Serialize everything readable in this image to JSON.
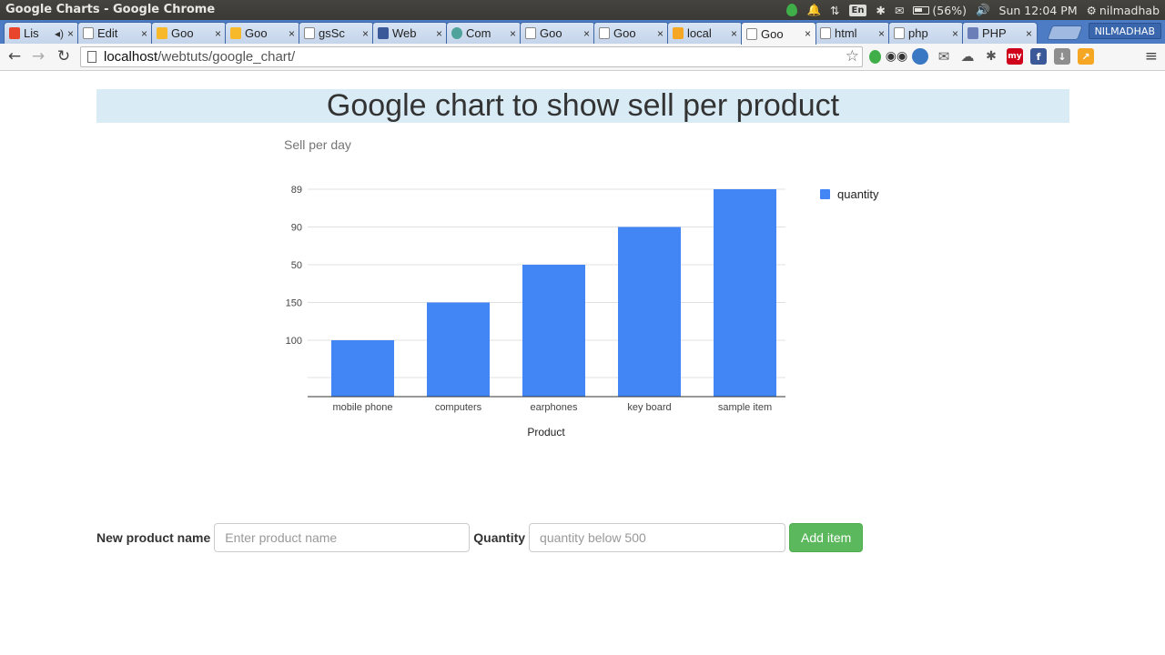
{
  "os_bar": {
    "window_title": "Google Charts - Google Chrome",
    "lang": "En",
    "battery": "(56%)",
    "clock": "Sun 12:04 PM",
    "user": "nilmadhab"
  },
  "tabs": [
    {
      "label": "Lis",
      "favicon": "gmail-icon",
      "audio": true
    },
    {
      "label": "Edit",
      "favicon": "document-icon"
    },
    {
      "label": "Goo",
      "favicon": "chart-icon"
    },
    {
      "label": "Goo",
      "favicon": "chart-icon"
    },
    {
      "label": "gsSc",
      "favicon": "document-icon"
    },
    {
      "label": "Web",
      "favicon": "facebook-icon"
    },
    {
      "label": "Com",
      "favicon": "leaf-icon"
    },
    {
      "label": "Goo",
      "favicon": "document-icon"
    },
    {
      "label": "Goo",
      "favicon": "document-icon"
    },
    {
      "label": "local",
      "favicon": "phpmyadmin-icon"
    },
    {
      "label": "Goo",
      "favicon": "document-icon",
      "active": true
    },
    {
      "label": "html",
      "favicon": "document-icon"
    },
    {
      "label": "php",
      "favicon": "document-icon"
    },
    {
      "label": "PHP",
      "favicon": "php-icon"
    }
  ],
  "profile_name": "NILMADHAB",
  "toolbar": {
    "url_host": "localhost",
    "url_path": "/webtuts/google_chart/"
  },
  "page": {
    "heading": "Google chart to show sell per product",
    "form": {
      "name_label": "New product name",
      "name_placeholder": "Enter product name",
      "qty_label": "Quantity",
      "qty_placeholder": "quantity below 500",
      "add_label": "Add item"
    }
  },
  "colors": {
    "bar": "#4285f4",
    "heading_bg": "#d9ebf5",
    "button": "#5cb85c"
  },
  "chart_data": {
    "type": "bar",
    "title": "Sell per day",
    "xlabel": "Product",
    "ylabel": "",
    "categories": [
      "mobile phone",
      "computers",
      "earphones",
      "key board",
      "sample item"
    ],
    "y_tick_labels": [
      "100",
      "150",
      "50",
      "90",
      "89"
    ],
    "series": [
      {
        "name": "quantity",
        "values": [
          100,
          150,
          50,
          90,
          89
        ]
      }
    ],
    "bar_rank": [
      1,
      2,
      3,
      4,
      5
    ],
    "grid": true,
    "legend": "right"
  }
}
